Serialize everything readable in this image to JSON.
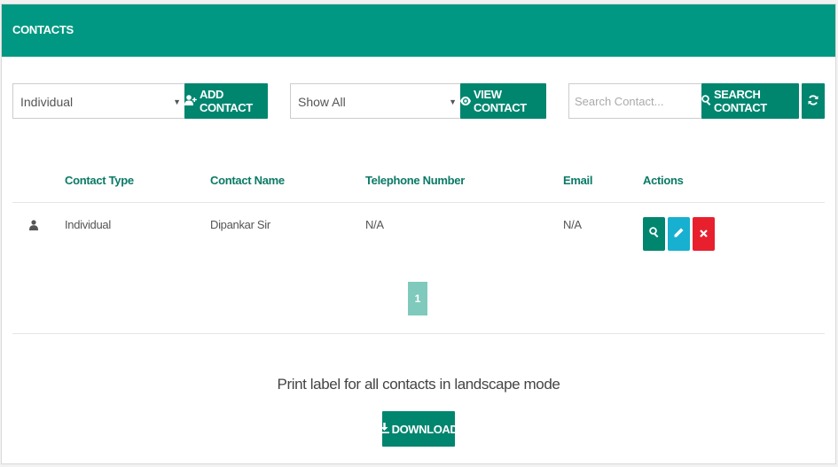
{
  "header": {
    "title": "CONTACTS"
  },
  "controls": {
    "type_select": {
      "value": "Individual"
    },
    "add_contact_label": "ADD CONTACT",
    "filter_select": {
      "value": "Show All"
    },
    "view_contact_label": "VIEW CONTACT",
    "search": {
      "placeholder": "Search Contact..."
    },
    "search_contact_label": "SEARCH CONTACT"
  },
  "table": {
    "columns": [
      "Contact Type",
      "Contact Name",
      "Telephone Number",
      "Email",
      "Actions"
    ],
    "rows": [
      {
        "type": "Individual",
        "name": "Dipankar Sir",
        "telephone": "N/A",
        "email": "N/A"
      }
    ]
  },
  "pagination": {
    "current_page": "1"
  },
  "print": {
    "text": "Print label for all contacts in landscape mode",
    "download_label": "DOWNLOAD"
  },
  "colors": {
    "header": "#009882",
    "primary_button": "#00856f",
    "edit_button": "#17b0d0",
    "delete_button": "#e8202e",
    "pagination_active": "#80c9bd"
  }
}
